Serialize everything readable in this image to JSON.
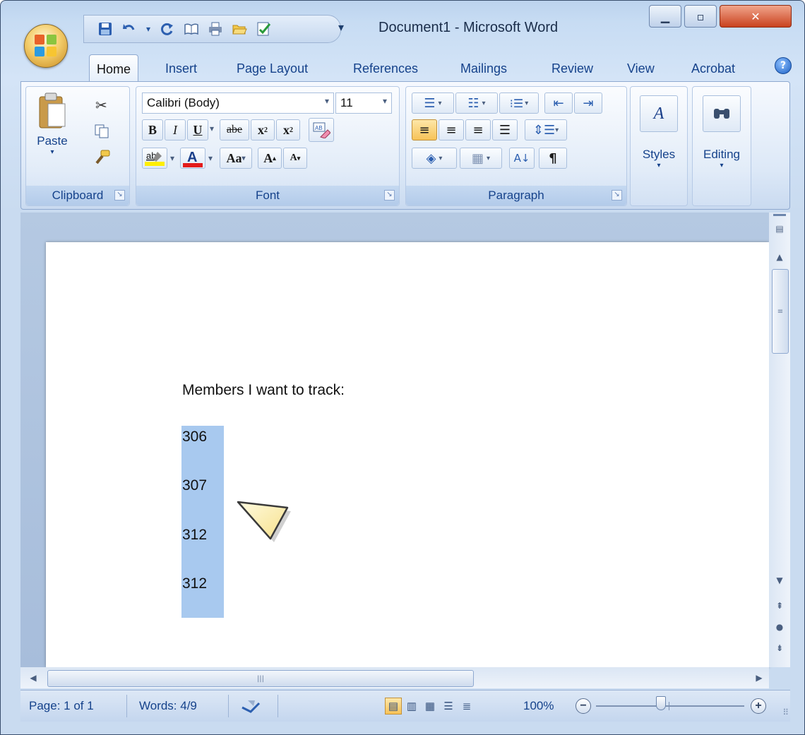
{
  "window": {
    "title": "Document1 - Microsoft Word"
  },
  "quick_access": {
    "icons": [
      "save-icon",
      "undo-icon",
      "redo-icon",
      "open-book-icon",
      "print-icon",
      "open-folder-icon",
      "check-icon"
    ]
  },
  "tabs": [
    {
      "label": "Home",
      "active": true
    },
    {
      "label": "Insert"
    },
    {
      "label": "Page Layout"
    },
    {
      "label": "References"
    },
    {
      "label": "Mailings"
    },
    {
      "label": "Review"
    },
    {
      "label": "View"
    },
    {
      "label": "Acrobat"
    }
  ],
  "ribbon": {
    "clipboard": {
      "label": "Clipboard",
      "paste": "Paste"
    },
    "font": {
      "label": "Font",
      "family": "Calibri (Body)",
      "size": "11",
      "bold": "B",
      "italic": "I",
      "underline": "U",
      "strike": "abe",
      "subscript": "x",
      "superscript": "x",
      "case": "Aa",
      "grow": "A",
      "shrink": "A",
      "color_accent": "#e31b1b",
      "highlight_accent": "#ffee00"
    },
    "paragraph": {
      "label": "Paragraph"
    },
    "styles": {
      "label": "Styles"
    },
    "editing": {
      "label": "Editing"
    }
  },
  "document": {
    "heading": "Members I want to track:",
    "numbers": [
      "306",
      "307",
      "312",
      "312"
    ],
    "selection_color": "#a8c9ef"
  },
  "status_bar": {
    "page": "Page: 1 of 1",
    "words": "Words: 4/9",
    "zoom": "100%"
  }
}
